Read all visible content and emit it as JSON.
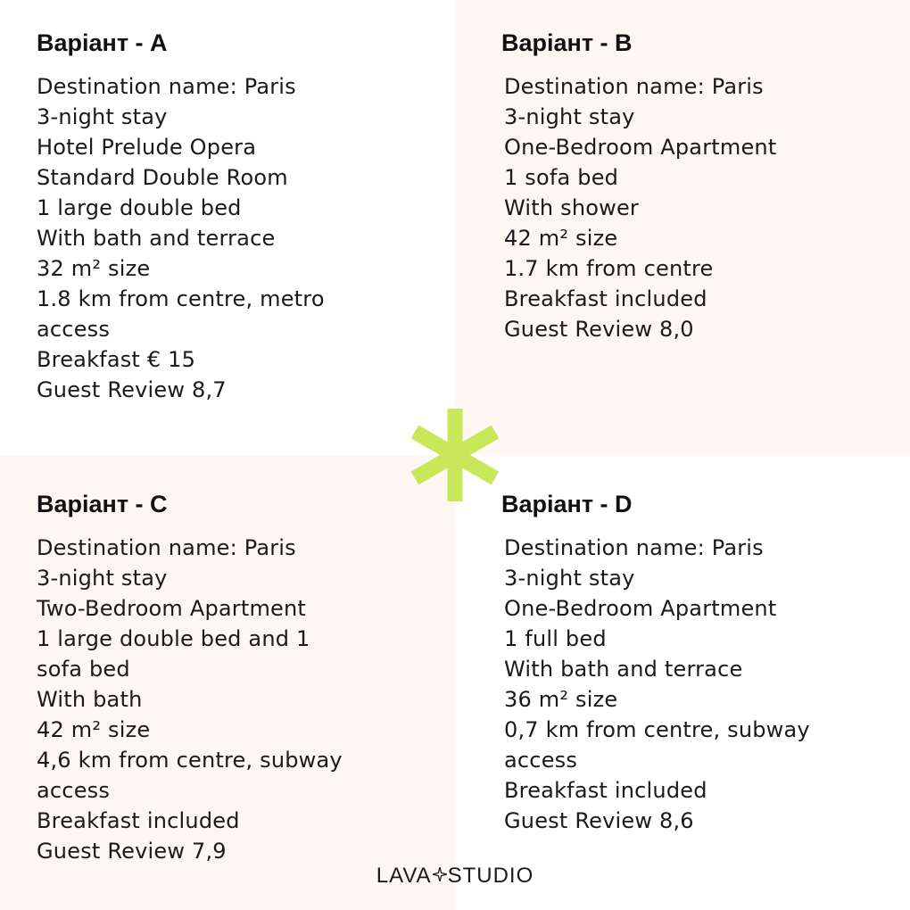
{
  "options": [
    {
      "title": "Варіант - A",
      "lines": [
        "Destination name: Paris",
        "3-night stay",
        "Hotel Prelude Opera",
        "Standard Double Room",
        "1 large double bed",
        "With bath and terrace",
        "32 m² size",
        "1.8 km from centre, metro",
        "access",
        "Breakfast € 15",
        "Guest Review 8,7"
      ]
    },
    {
      "title": "Варіант - B",
      "lines": [
        "Destination name: Paris",
        "3-night stay",
        "One-Bedroom Apartment",
        "1 sofa bed",
        "With shower",
        "42 m² size",
        "1.7 km from centre",
        "Breakfast included",
        "Guest Review 8,0"
      ]
    },
    {
      "title": "Варіант - C",
      "lines": [
        "Destination name: Paris",
        "3-night stay",
        "Two-Bedroom Apartment",
        "1 large double bed and 1",
        "sofa bed",
        "With bath",
        "42 m² size",
        "4,6 km from centre, subway",
        "access",
        "Breakfast included",
        "Guest Review 7,9"
      ]
    },
    {
      "title": "Варіант - D",
      "lines": [
        "Destination name: Paris",
        "3-night stay",
        "One-Bedroom Apartment",
        "1 full bed",
        "With bath and terrace",
        "36 m² size",
        "0,7 km from centre, subway",
        "access",
        "Breakfast included",
        "Guest Review 8,6"
      ]
    }
  ],
  "logo": {
    "left": "LAVA",
    "right": "STUDIO"
  },
  "colors": {
    "accent": "#c8e85a",
    "cream": "#fcf7f0",
    "text": "#111111"
  },
  "icons": {
    "center": "asterisk-icon",
    "logo_mark": "sparkle-icon"
  }
}
